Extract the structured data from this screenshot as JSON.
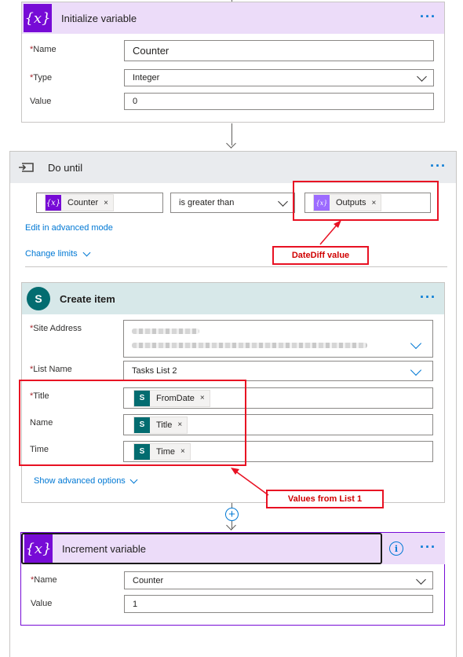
{
  "init_var": {
    "title": "Initialize variable",
    "more": "···",
    "name_label": "Name",
    "name_value": "Counter",
    "type_label": "Type",
    "type_value": "Integer",
    "value_label": "Value",
    "value_value": "0",
    "required_mark": "*"
  },
  "do_until": {
    "title": "Do until",
    "more": "···",
    "condition": {
      "left_token": "Counter",
      "operator": "is greater than",
      "right_token": "Outputs",
      "remove": "×"
    },
    "edit_advanced": "Edit in advanced mode",
    "change_limits": "Change limits",
    "callout": "DateDiff value"
  },
  "create_item": {
    "title": "Create item",
    "more": "···",
    "site_address_label": "Site Address",
    "list_name_label": "List Name",
    "list_name_value": "Tasks List 2",
    "title_label": "Title",
    "title_token": "FromDate",
    "name_label": "Name",
    "name_token": "Title",
    "time_label": "Time",
    "time_token": "Time",
    "remove": "×",
    "show_advanced": "Show advanced options",
    "callout": "Values from List 1"
  },
  "increment_var": {
    "title": "Increment variable",
    "more": "···",
    "info": "i",
    "name_label": "Name",
    "name_value": "Counter",
    "value_label": "Value",
    "value_value": "1"
  },
  "icons": {
    "variable": "{x}",
    "sharepoint": "S",
    "loop": "loop-icon",
    "add": "+"
  },
  "colors": {
    "accent": "#0078d4",
    "variable_purple": "#770bd6",
    "sharepoint_teal": "#036c70",
    "callout_red": "#e81123"
  }
}
